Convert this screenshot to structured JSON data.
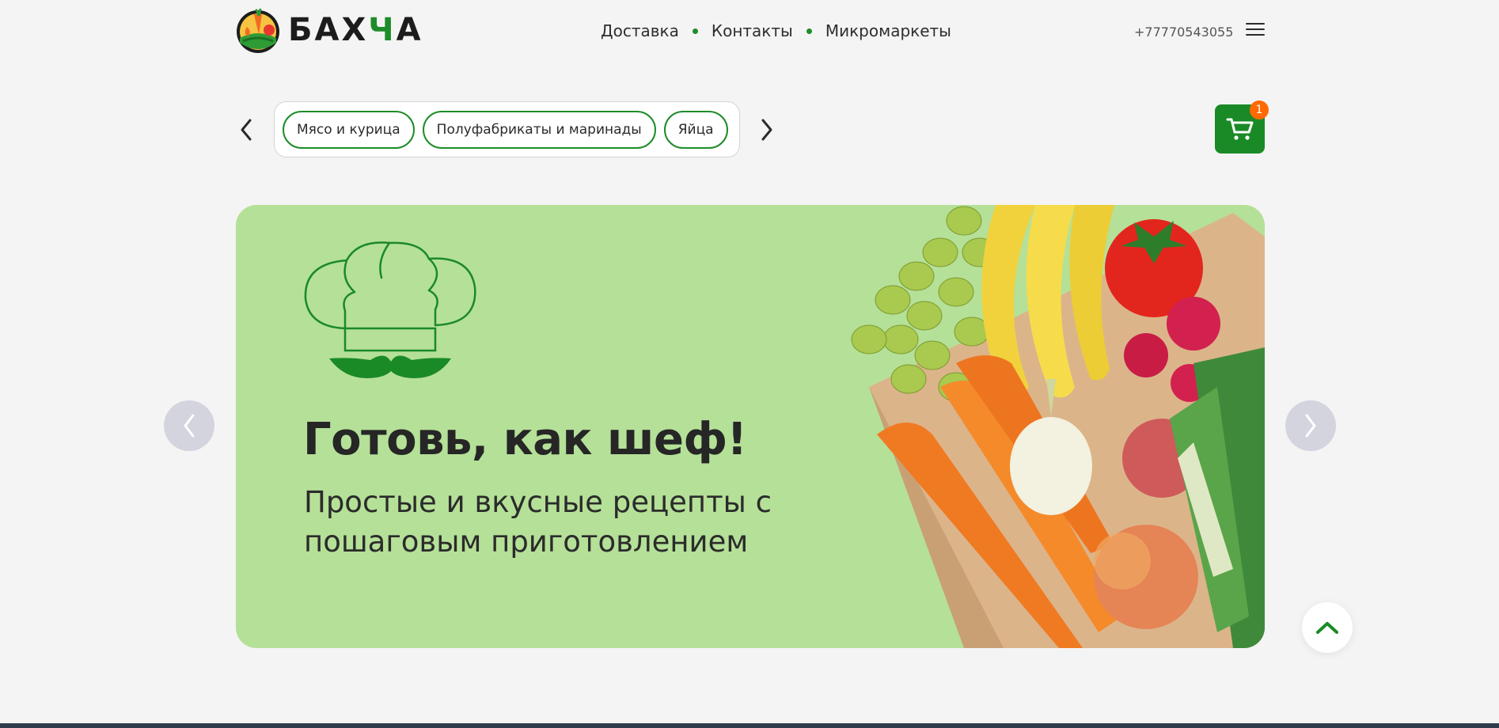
{
  "header": {
    "logo_text_main": "БАХ",
    "logo_text_accent": "Ч",
    "logo_text_end": "А",
    "nav": [
      {
        "label": "Доставка"
      },
      {
        "label": "Контакты"
      },
      {
        "label": "Микромаркеты"
      }
    ],
    "phone": "+77770543055",
    "menu_icon": "hamburger-icon"
  },
  "categories": {
    "items": [
      {
        "label": "Мясо и курица"
      },
      {
        "label": "Полуфабрикаты и маринады"
      },
      {
        "label": "Яйца"
      }
    ]
  },
  "cart": {
    "count": "1",
    "icon": "cart-icon"
  },
  "banner": {
    "headline": "Готовь, как шеф!",
    "subtitle": "Простые и вкусные рецепты с пошаговым приготовлением"
  },
  "colors": {
    "brand_green": "#1a8a26",
    "banner_bg": "#b5e098",
    "badge_orange": "#ff6a00",
    "page_bg": "#f4f4f4"
  }
}
